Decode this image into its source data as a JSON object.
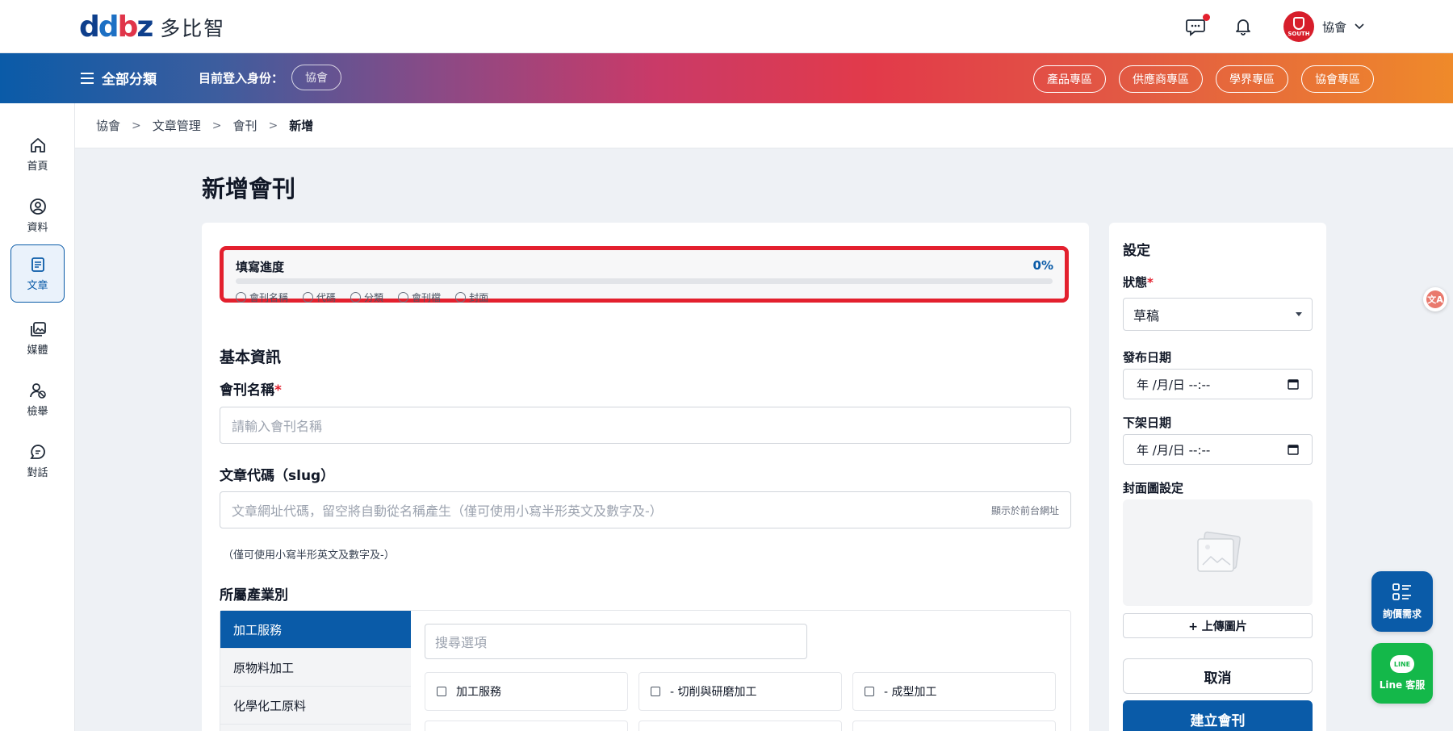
{
  "brand": {
    "logo_text": "多比智",
    "colors": {
      "primary": "#0a5ba8",
      "alert": "#e3202e",
      "line_green": "#14b84a"
    }
  },
  "header": {
    "icons": [
      "chat-notification-icon",
      "bell-icon",
      "chevron-down-icon"
    ],
    "user_name": "協會",
    "avatar_text": "SOUTH"
  },
  "nav": {
    "all_categories": "全部分類",
    "login_label": "目前登入身份：",
    "login_role": "協會",
    "zones": [
      "產品專區",
      "供應商專區",
      "學界專區",
      "協會專區"
    ]
  },
  "sidebar": {
    "items": [
      {
        "label": "首頁",
        "icon": "home-icon"
      },
      {
        "label": "資料",
        "icon": "user-circle-icon"
      },
      {
        "label": "文章",
        "icon": "document-icon",
        "active": true
      },
      {
        "label": "媒體",
        "icon": "media-library-icon"
      },
      {
        "label": "檢舉",
        "icon": "report-user-icon"
      },
      {
        "label": "對話",
        "icon": "chat-bubble-icon"
      }
    ]
  },
  "breadcrumb": {
    "items": [
      "協會",
      "文章管理",
      "會刊",
      "新增"
    ]
  },
  "page": {
    "title": "新增會刊"
  },
  "progress": {
    "title": "填寫進度",
    "percent_text": "0%",
    "percent_value": 0,
    "steps": [
      "會刊名稱",
      "代碼",
      "分類",
      "會刊檔",
      "封面"
    ]
  },
  "form": {
    "section_basic": "基本資訊",
    "name_label": "會刊名稱",
    "required_mark": "*",
    "name_placeholder": "請輸入會刊名稱",
    "slug_label": "文章代碼（slug）",
    "slug_placeholder": "文章網址代碼，留空將自動從名稱產生（僅可使用小寫半形英文及數字及-）",
    "slug_suffix": "顯示於前台網址",
    "slug_hint": "（僅可使用小寫半形英文及數字及-）",
    "industry_label": "所屬產業別",
    "industry_categories": [
      "加工服務",
      "原物料加工",
      "化學化工原料"
    ],
    "search_placeholder": "搜尋選項",
    "options": [
      "加工服務",
      "- 切削與研磨加工",
      "- 成型加工"
    ]
  },
  "settings": {
    "title": "設定",
    "status_label": "狀態",
    "status_value": "草稿",
    "publish_label": "發布日期",
    "publish_value": "年 /月/日 --:--",
    "unpublish_label": "下架日期",
    "unpublish_value": "年 /月/日 --:--",
    "cover_label": "封面圖設定",
    "upload_label": "+ 上傳圖片",
    "cancel_label": "取消",
    "create_label": "建立會刊"
  },
  "floating": {
    "translate_icon": "translate-icon",
    "quote_label": "詢價需求",
    "line_label": "Line 客服",
    "line_bubble_text": "LINE"
  }
}
